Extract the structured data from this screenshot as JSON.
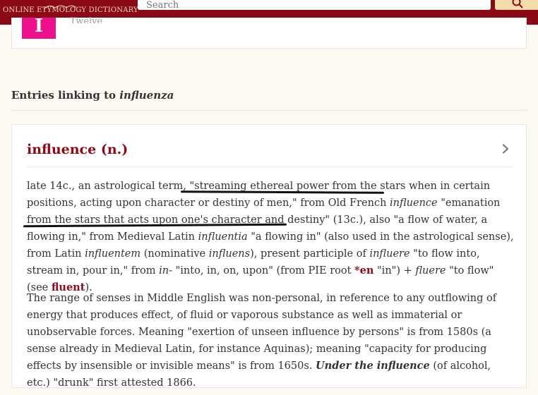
{
  "header": {
    "logo_text": "ONLINE ETYMOLOGY DICTIONARY",
    "search_placeholder": "Search",
    "search_icon": "search-icon"
  },
  "previous_entry": {
    "badge": "I",
    "subtitle": "Twelve"
  },
  "linking_section": {
    "heading_prefix": "Entries linking to ",
    "heading_word": "influenza"
  },
  "entry": {
    "title": "influence (n.)",
    "chevron_icon": "chevron-right-icon",
    "p1": {
      "s1": "late 14c., an astrological term, ",
      "s2": "\"streaming ethereal power from the stars",
      "s3": " when in certain positions, acting upon character or destiny of men,\" from Old French ",
      "e1": "influence",
      "s4": " \"emanation from the stars that acts upon one's character and destiny\" (13c.), also \"a flow of water, a flowing in,\" from Medieval Latin ",
      "e2": "influentia",
      "s5": " \"a flowing in\" (also used in the astrological sense), from Latin ",
      "e3": "influentem",
      "s6": " (nominative ",
      "e4": "influens",
      "s7": "), present participle of ",
      "e5": "influere",
      "s8": " \"to flow into, stream in, pour in,\" from ",
      "e6": "in-",
      "s9": " \"into, in, on, upon\" (from PIE root ",
      "x1": "*en",
      "s10": " \"in\") + ",
      "e7": "fluere",
      "s11": " \"to flow\" (see ",
      "x2": "fluent",
      "s12": ")."
    },
    "p2": {
      "s1": "The range of senses in Middle English was non-personal, in reference to any outflowing of energy that produces effect, of fluid or vaporous substance as well as immaterial or unobservable forces. Meaning \"exertion of unseen influence by persons\" is from 1580s (a sense already in Medieval Latin, for instance Aquinas); meaning \"capacity for producing effects by insensible or invisible means\" is from 1650s. ",
      "b1": "Under the influence",
      "s2": " (of alcohol, etc.) \"drunk\" first attested 1866."
    }
  }
}
